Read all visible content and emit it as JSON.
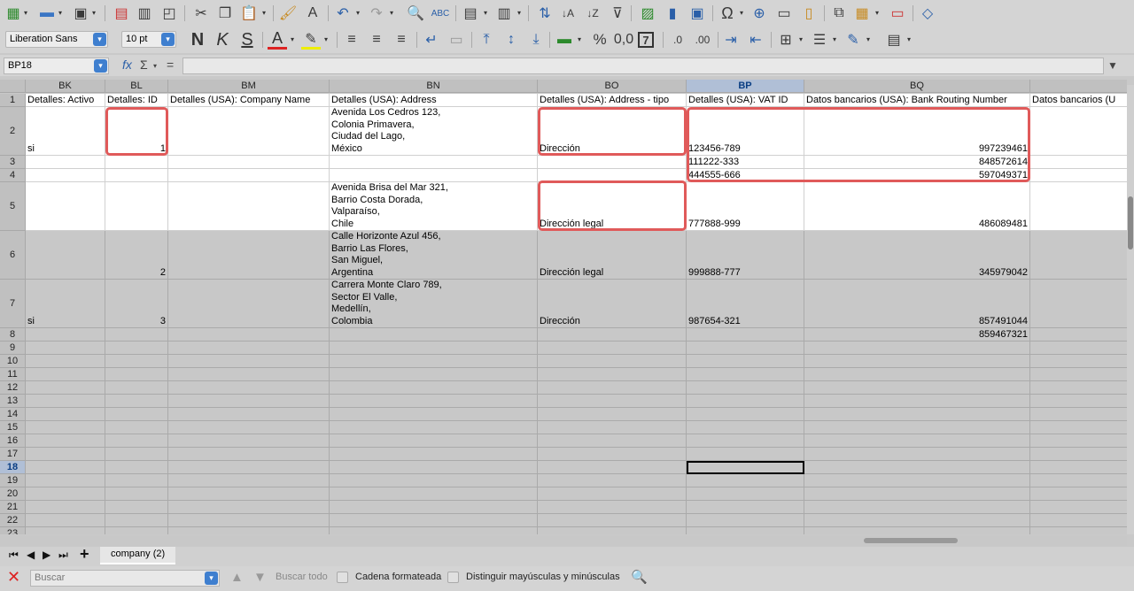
{
  "toolbar1": {
    "icons": [
      "new-icon",
      "open-icon",
      "save-icon",
      "export-pdf-icon",
      "print-icon",
      "print-preview-icon",
      "cut-icon",
      "copy-icon",
      "paste-icon",
      "clone-formatting-icon",
      "clear-formatting-icon",
      "undo-icon",
      "redo-icon",
      "find-replace-icon",
      "spelling-icon",
      "row-icon",
      "column-icon",
      "sort-icon",
      "sort-ascending-icon",
      "sort-descending-icon",
      "autofilter-icon",
      "image-icon",
      "chart-icon",
      "pivot-table-icon",
      "special-character-icon",
      "hyperlink-icon",
      "comment-icon",
      "header-footer-icon",
      "define-print-area-icon",
      "freeze-rows-icon",
      "split-window-icon",
      "show-draw-functions-icon"
    ]
  },
  "toolbar2": {
    "font_name": "Liberation Sans",
    "font_size": "10 pt",
    "bold_label": "N",
    "italic_label": "K",
    "underline_label": "S",
    "font_color_label": "A",
    "percent_label": "%",
    "number_label": "0,0",
    "date_label": "7"
  },
  "formula_bar": {
    "name_box": "BP18",
    "fx_label": "fx",
    "sum_label": "Σ",
    "equals_label": "=",
    "value": ""
  },
  "columns": [
    {
      "id": "BK",
      "selected": false
    },
    {
      "id": "BL",
      "selected": false
    },
    {
      "id": "BM",
      "selected": false
    },
    {
      "id": "BN",
      "selected": false
    },
    {
      "id": "BO",
      "selected": false
    },
    {
      "id": "BP",
      "selected": true
    },
    {
      "id": "BQ",
      "selected": false
    },
    {
      "id": "",
      "selected": false
    }
  ],
  "rows": [
    "1",
    "2",
    "3",
    "4",
    "5",
    "6",
    "7",
    "8",
    "9",
    "10",
    "11",
    "12",
    "13",
    "14",
    "15",
    "16",
    "17",
    "18",
    "19",
    "20",
    "21",
    "22",
    "23"
  ],
  "selected_row": "18",
  "cells": {
    "r1": [
      "Detalles: Activo",
      "Detalles: ID",
      "Detalles (USA): Company Name",
      "Detalles (USA): Address",
      "Detalles (USA): Address - tipo",
      "Detalles (USA): VAT ID",
      "Datos bancarios (USA): Bank Routing Number",
      "Datos bancarios (U"
    ],
    "r2": [
      "si",
      "1",
      "",
      "Avenida Los Cedros 123,\nColonia Primavera,\nCiudad del Lago,\nMéxico",
      "Dirección",
      "123456-789",
      "997239461",
      ""
    ],
    "r3": [
      "",
      "",
      "",
      "",
      "",
      "111222-333",
      "848572614",
      ""
    ],
    "r4": [
      "",
      "",
      "",
      "",
      "",
      "444555-666",
      "597049371",
      ""
    ],
    "r5": [
      "",
      "",
      "",
      "Avenida Brisa del Mar 321,\nBarrio Costa Dorada,\nValparaíso,\nChile",
      "Dirección legal",
      "777888-999",
      "486089481",
      ""
    ],
    "r6": [
      "",
      "2",
      "",
      "Calle Horizonte Azul 456,\nBarrio Las Flores,\nSan Miguel,\nArgentina",
      "Dirección legal",
      "999888-777",
      "345979042",
      ""
    ],
    "r7": [
      "si",
      "3",
      "",
      "Carrera Monte Claro 789,\nSector El Valle,\nMedellín,\nColombia",
      "Dirección",
      "987654-321",
      "857491044",
      ""
    ],
    "r8": [
      "",
      "",
      "",
      "",
      "",
      "",
      "859467321",
      ""
    ]
  },
  "sheet_tabs": {
    "add_label": "+",
    "active": "company (2)"
  },
  "find_bar": {
    "placeholder": "Buscar",
    "find_all": "Buscar todo",
    "formatted": "Cadena formateada",
    "match_case": "Distinguir mayúsculas y minúsculas"
  }
}
